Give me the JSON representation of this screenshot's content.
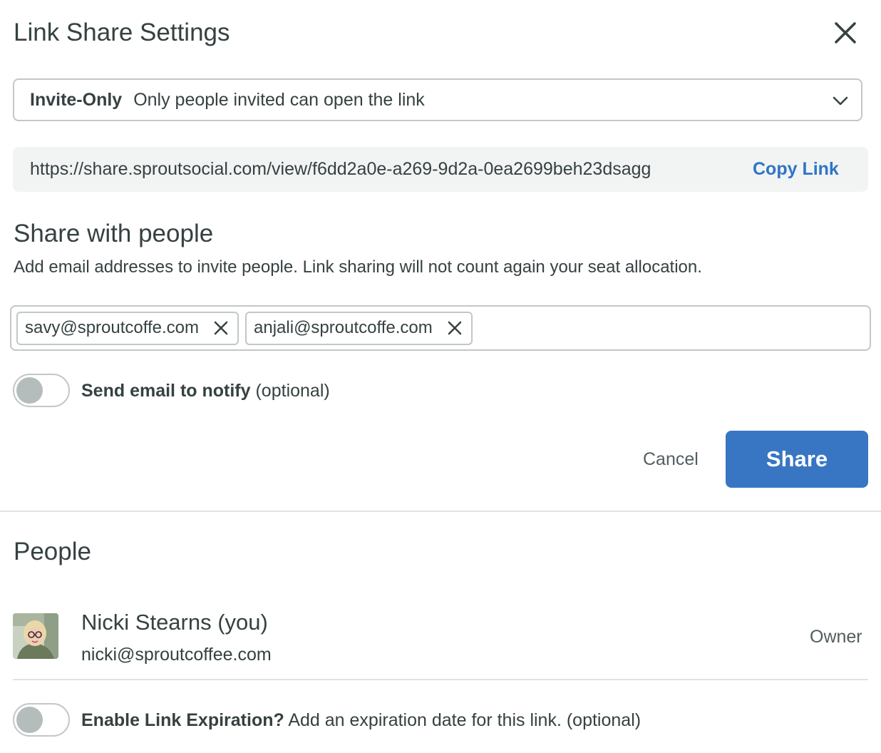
{
  "dialog": {
    "title": "Link Share Settings",
    "close_icon": "close-icon"
  },
  "access": {
    "selected_label": "Invite-Only",
    "selected_description": "Only people invited can open the link",
    "dropdown_icon": "chevron-down-icon"
  },
  "link": {
    "url": "https://share.sproutsocial.com/view/f6dd2a0e-a269-9d2a-0ea2699beh23dsagg",
    "copy_label": "Copy Link"
  },
  "share_with_people": {
    "heading": "Share with people",
    "help_text": "Add email addresses to invite people. Link sharing will not count again your seat allocation.",
    "emails": [
      "savy@sproutcoffe.com",
      "anjali@sproutcoffe.com"
    ]
  },
  "notify": {
    "label_bold": "Send email to notify",
    "label_optional": "(optional)",
    "enabled": false
  },
  "actions": {
    "cancel_label": "Cancel",
    "share_label": "Share"
  },
  "people": {
    "heading": "People",
    "members": [
      {
        "name": "Nicki Stearns (you)",
        "email": "nicki@sproutcoffee.com",
        "role": "Owner"
      }
    ]
  },
  "expiration": {
    "label_bold": "Enable Link Expiration?",
    "label_rest": "Add an expiration date for this link. (optional)",
    "enabled": false
  },
  "colors": {
    "primary": "#3876c3",
    "link": "#2f75c6",
    "text": "#364141",
    "border": "#c3c7c7",
    "url_bg": "#f2f4f4"
  }
}
